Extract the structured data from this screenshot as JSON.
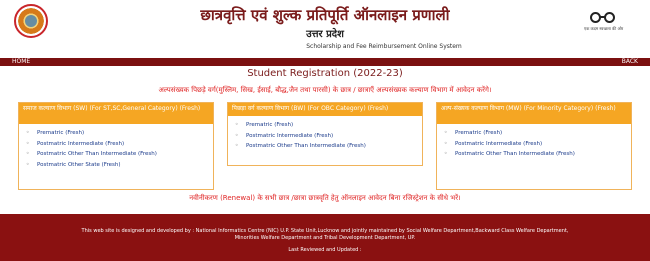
{
  "header": {
    "title_hindi": "छात्रवृत्ति एवं शुल्क प्रतिपूर्ति ऑनलाइन प्रणाली",
    "state_hindi": "उत्तर प्रदेश",
    "title_english": "Scholarship and Fee Reimbursement Online System",
    "swachh_text": "एक कदम स्वच्छता की ओर"
  },
  "nav": {
    "home": "HOME",
    "back": "BACK"
  },
  "main": {
    "page_title": "Student Registration (2022-23)",
    "notice": "अल्पसंख्यक पिछड़े वर्ग(मुस्लिम, सिख, ईसाई, बौद्ध,जैन तथा पारसी) के छात्र / छात्राएँ अल्पसंख्यक कल्याण विभाग में आवेदन करेंगे।",
    "renewal_notice": "नवीनीकरण (Renewal) के सभी छात्र /छात्रा छात्रवृति हेतु ऑनलाइन आवेदन बिना रजिस्ट्रेशन के सीधे भरें।"
  },
  "panels": [
    {
      "title": "समाज कल्याण विभाग (SW) (For ST,SC,General Category) (Fresh)",
      "items": [
        "Prematric (Fresh)",
        "Postmatric Intermediate (Fresh)",
        "Postmatric Other Than Intermediate (Fresh)",
        "Postmatric Other State (Fresh)"
      ]
    },
    {
      "title": "पिछड़ा वर्ग कल्याण विभाग (BW) (For OBC Category) (Fresh)",
      "items": [
        "Prematric (Fresh)",
        "Postmatric Intermediate (Fresh)",
        "Postmatric Other Than Intermediate (Fresh)"
      ]
    },
    {
      "title": "अल्प-संख्यक कल्याण विभाग (MW) (For Minority Category) (Fresh)",
      "items": [
        "Prematric (Fresh)",
        "Postmatric Intermediate (Fresh)",
        "Postmatric Other Than Intermediate (Fresh)"
      ]
    }
  ],
  "footer": {
    "line1": "This web site is designed and developed by : National Informatics Centre (NIC) U.P. State Unit,Lucknow and jointly maintained by Social Welfare Department,Backward Class Welfare Department,",
    "line2": "Minorities Welfare Department and Tribal Development Department, UP.",
    "line3": "Last Reviewed and Updated :"
  }
}
